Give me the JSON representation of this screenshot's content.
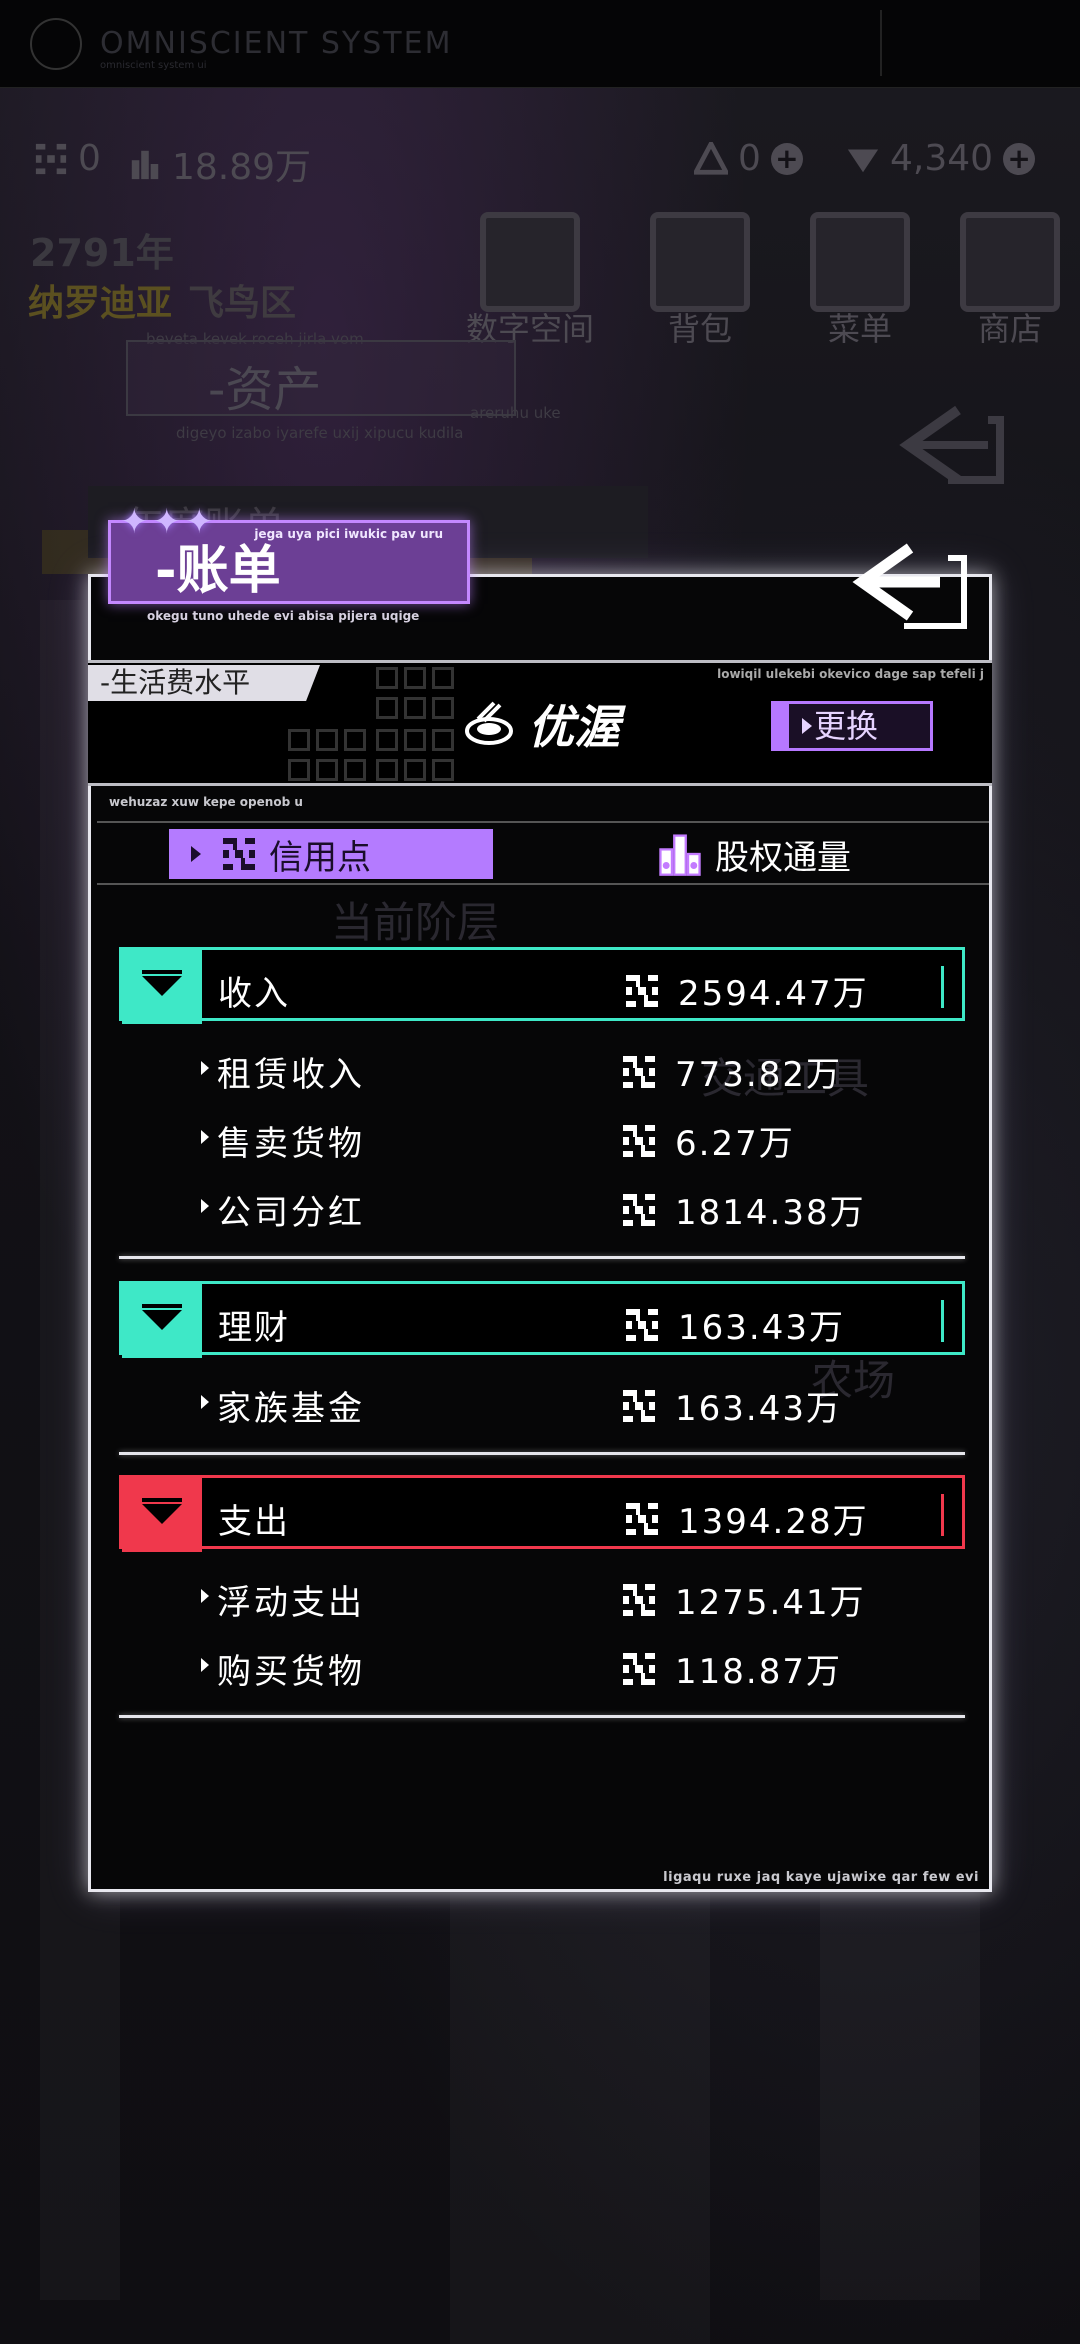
{
  "system": {
    "title": "OMNISCIENT SYSTEM",
    "subtitle": "omniscient system ui"
  },
  "resources": {
    "credits": "0",
    "equity": "18.89万",
    "gems": "0",
    "diamonds": "4,340"
  },
  "background": {
    "year": "2791年",
    "place_main": "纳罗迪亚",
    "place_district": "飞鸟区",
    "nav": [
      "数字空间",
      "背包",
      "菜单",
      "商店"
    ],
    "asset_title": "-资产",
    "asset_line1": "beveta kevek roceh jirla vom",
    "asset_line2": "digeyo izabo iyarefe uxij xipucu kudila",
    "asset_line3": "areruhu uke",
    "annual_bill": "-年度账单",
    "faded_text_1": "当前阶层",
    "faded_text_2": "交通工具",
    "faded_text_3": "农场"
  },
  "panel": {
    "title": "-账单",
    "title_sub1": "jega uya pici iwukic pav uru",
    "title_sub2": "okegu tuno uhede evi abisa pijera uqige",
    "life_label": "-生活费水平",
    "life_tiny": "lowiqil ulekebi okevico dage sap tefeli j",
    "brand_name": "优渥",
    "change_button": "更换",
    "small_caption": "wehuzaz xuw kepe openob u",
    "footer_text": "ligaqu ruxe jaq kaye ujawixe qar few evi",
    "tabs": [
      {
        "label": "信用点",
        "active": true
      },
      {
        "label": "股权通量",
        "active": false
      }
    ]
  },
  "sections": [
    {
      "name": "收入",
      "amount": "2594.47万",
      "color": "#3ee8c7",
      "rows": [
        {
          "name": "租赁收入",
          "amount": "773.82万"
        },
        {
          "name": "售卖货物",
          "amount": "6.27万"
        },
        {
          "name": "公司分红",
          "amount": "1814.38万"
        }
      ]
    },
    {
      "name": "理财",
      "amount": "163.43万",
      "color": "#3ee8c7",
      "rows": [
        {
          "name": "家族基金",
          "amount": "163.43万"
        }
      ]
    },
    {
      "name": "支出",
      "amount": "1394.28万",
      "color": "#f0384c",
      "rows": [
        {
          "name": "浮动支出",
          "amount": "1275.41万"
        },
        {
          "name": "购买货物",
          "amount": "118.87万"
        }
      ]
    }
  ]
}
